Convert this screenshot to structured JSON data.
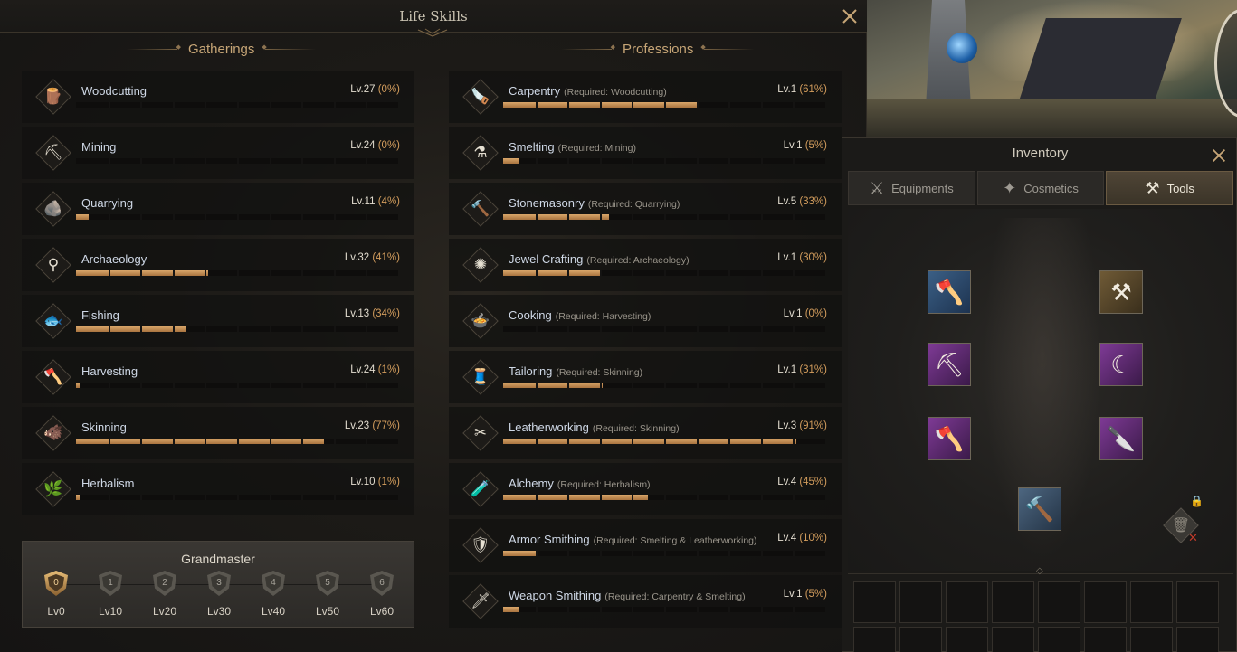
{
  "lifeskills": {
    "title": "Life Skills",
    "gatherings_title": "Gatherings",
    "professions_title": "Professions",
    "gatherings": [
      {
        "icon": "woodcutting-icon",
        "glyph": "🪵",
        "name": "Woodcutting",
        "level": "Lv.27",
        "percent": "(0%)",
        "progress": 0.0
      },
      {
        "icon": "mining-icon",
        "glyph": "⛏",
        "name": "Mining",
        "level": "Lv.24",
        "percent": "(0%)",
        "progress": 0.0
      },
      {
        "icon": "quarrying-icon",
        "glyph": "🪨",
        "name": "Quarrying",
        "level": "Lv.11",
        "percent": "(4%)",
        "progress": 0.04
      },
      {
        "icon": "archaeology-icon",
        "glyph": "⚲",
        "name": "Archaeology",
        "level": "Lv.32",
        "percent": "(41%)",
        "progress": 0.41
      },
      {
        "icon": "fishing-icon",
        "glyph": "🐟",
        "name": "Fishing",
        "level": "Lv.13",
        "percent": "(34%)",
        "progress": 0.34
      },
      {
        "icon": "harvesting-icon",
        "glyph": "🪓",
        "name": "Harvesting",
        "level": "Lv.24",
        "percent": "(1%)",
        "progress": 0.01
      },
      {
        "icon": "skinning-icon",
        "glyph": "🐗",
        "name": "Skinning",
        "level": "Lv.23",
        "percent": "(77%)",
        "progress": 0.77
      },
      {
        "icon": "herbalism-icon",
        "glyph": "🌿",
        "name": "Herbalism",
        "level": "Lv.10",
        "percent": "(1%)",
        "progress": 0.01
      }
    ],
    "professions": [
      {
        "icon": "carpentry-icon",
        "glyph": "🪚",
        "name": "Carpentry",
        "req": "(Required: Woodcutting)",
        "level": "Lv.1",
        "percent": "(61%)",
        "progress": 0.61
      },
      {
        "icon": "smelting-icon",
        "glyph": "⚗",
        "name": "Smelting",
        "req": "(Required: Mining)",
        "level": "Lv.1",
        "percent": "(5%)",
        "progress": 0.05
      },
      {
        "icon": "stonemasonry-icon",
        "glyph": "🔨",
        "name": "Stonemasonry",
        "req": "(Required: Quarrying)",
        "level": "Lv.5",
        "percent": "(33%)",
        "progress": 0.33
      },
      {
        "icon": "jewel-crafting-icon",
        "glyph": "✺",
        "name": "Jewel Crafting",
        "req": "(Required: Archaeology)",
        "level": "Lv.1",
        "percent": "(30%)",
        "progress": 0.3
      },
      {
        "icon": "cooking-icon",
        "glyph": "🍲",
        "name": "Cooking",
        "req": "(Required: Harvesting)",
        "level": "Lv.1",
        "percent": "(0%)",
        "progress": 0.0
      },
      {
        "icon": "tailoring-icon",
        "glyph": "🧵",
        "name": "Tailoring",
        "req": "(Required: Skinning)",
        "level": "Lv.1",
        "percent": "(31%)",
        "progress": 0.31
      },
      {
        "icon": "leatherworking-icon",
        "glyph": "✂",
        "name": "Leatherworking",
        "req": "(Required: Skinning)",
        "level": "Lv.3",
        "percent": "(91%)",
        "progress": 0.91
      },
      {
        "icon": "alchemy-icon",
        "glyph": "🧪",
        "name": "Alchemy",
        "req": "(Required: Herbalism)",
        "level": "Lv.4",
        "percent": "(45%)",
        "progress": 0.45
      },
      {
        "icon": "armor-smithing-icon",
        "glyph": "🛡",
        "name": "Armor Smithing",
        "req": "(Required: Smelting & Leatherworking)",
        "level": "Lv.4",
        "percent": "(10%)",
        "progress": 0.1
      },
      {
        "icon": "weapon-smithing-icon",
        "glyph": "🗡",
        "name": "Weapon Smithing",
        "req": "(Required: Carpentry & Smelting)",
        "level": "Lv.1",
        "percent": "(5%)",
        "progress": 0.05
      }
    ],
    "grandmaster": {
      "title": "Grandmaster",
      "tiers": [
        {
          "num": "0",
          "label": "Lv0",
          "active": true
        },
        {
          "num": "1",
          "label": "Lv10",
          "active": false
        },
        {
          "num": "2",
          "label": "Lv20",
          "active": false
        },
        {
          "num": "3",
          "label": "Lv30",
          "active": false
        },
        {
          "num": "4",
          "label": "Lv40",
          "active": false
        },
        {
          "num": "5",
          "label": "Lv50",
          "active": false
        },
        {
          "num": "6",
          "label": "Lv60",
          "active": false
        }
      ]
    }
  },
  "inventory": {
    "title": "Inventory",
    "tabs": [
      {
        "label": "Equipments",
        "icon": "equipments-icon",
        "glyph": "⚔",
        "active": false
      },
      {
        "label": "Cosmetics",
        "icon": "cosmetics-icon",
        "glyph": "✦",
        "active": false
      },
      {
        "label": "Tools",
        "icon": "tools-icon",
        "glyph": "⚒",
        "active": true
      }
    ],
    "tools": [
      {
        "icon": "woodcutting-axe-icon",
        "glyph": "🪓",
        "rarity": "blue"
      },
      {
        "icon": "stonemason-hammer-icon",
        "glyph": "⚒",
        "rarity": "gold"
      },
      {
        "icon": "pickaxe-icon",
        "glyph": "⛏",
        "rarity": "purple"
      },
      {
        "icon": "sickle-icon",
        "glyph": "☾",
        "rarity": "purple"
      },
      {
        "icon": "harvest-axe-icon",
        "glyph": "🪓",
        "rarity": "purple"
      },
      {
        "icon": "skinning-knife-icon",
        "glyph": "🔪",
        "rarity": "purple"
      },
      {
        "icon": "smithing-hammer-icon",
        "glyph": "🔨",
        "rarity": "steel"
      }
    ]
  },
  "colors": {
    "accent_gold": "#c6a576",
    "progress_fill": "#d9a66a",
    "percent_text": "#d39d5d"
  }
}
